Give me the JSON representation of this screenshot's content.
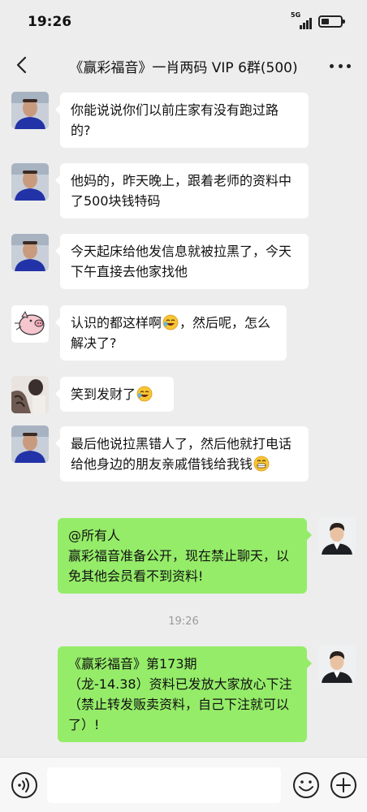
{
  "status_bar": {
    "time": "19:26",
    "network": "5G"
  },
  "nav": {
    "title": "《赢彩福音》一肖两码 VIP 6群(500)"
  },
  "messages": [
    {
      "side": "left",
      "avatar": "man-blue-shirt-avatar",
      "text": "你能说说你们以前庄家有没有跑过路的?"
    },
    {
      "side": "left",
      "avatar": "man-blue-shirt-avatar",
      "text": "他妈的，昨天晚上，跟着老师的资料中了500块钱特码"
    },
    {
      "side": "left",
      "avatar": "man-blue-shirt-avatar",
      "text": "今天起床给他发信息就被拉黑了，今天下午直接去他家找他"
    },
    {
      "side": "left",
      "avatar": "pig-cartoon-avatar",
      "text_before": "认识的都这样啊",
      "emoji": "rofl-emoji",
      "text_after": "，然后呢，怎么解决了?"
    },
    {
      "side": "left",
      "avatar": "tattoo-arm-avatar",
      "text_before": "笑到发财了",
      "emoji": "rofl-emoji",
      "text_after": ""
    },
    {
      "side": "left",
      "avatar": "man-blue-shirt-avatar",
      "text_before": "最后他说拉黑错人了，然后他就打电话给他身边的朋友亲戚借钱给我钱",
      "emoji": "grin-emoji",
      "text_after": ""
    },
    {
      "side": "right",
      "avatar": "man-suit-avatar",
      "mention": "@所有人",
      "text": "赢彩福音准备公开，现在禁止聊天，以免其他会员看不到资料!"
    },
    {
      "side": "right",
      "avatar": "man-suit-avatar",
      "line1": "《赢彩福音》第173期",
      "text": "（龙-14.38）资料已发放大家放心下注（禁止转发贩卖资料，自己下注就可以了）!"
    }
  ],
  "timestamp": "19:26",
  "colors": {
    "background": "#ededed",
    "bubble_left": "#ffffff",
    "bubble_right": "#95ec69"
  }
}
